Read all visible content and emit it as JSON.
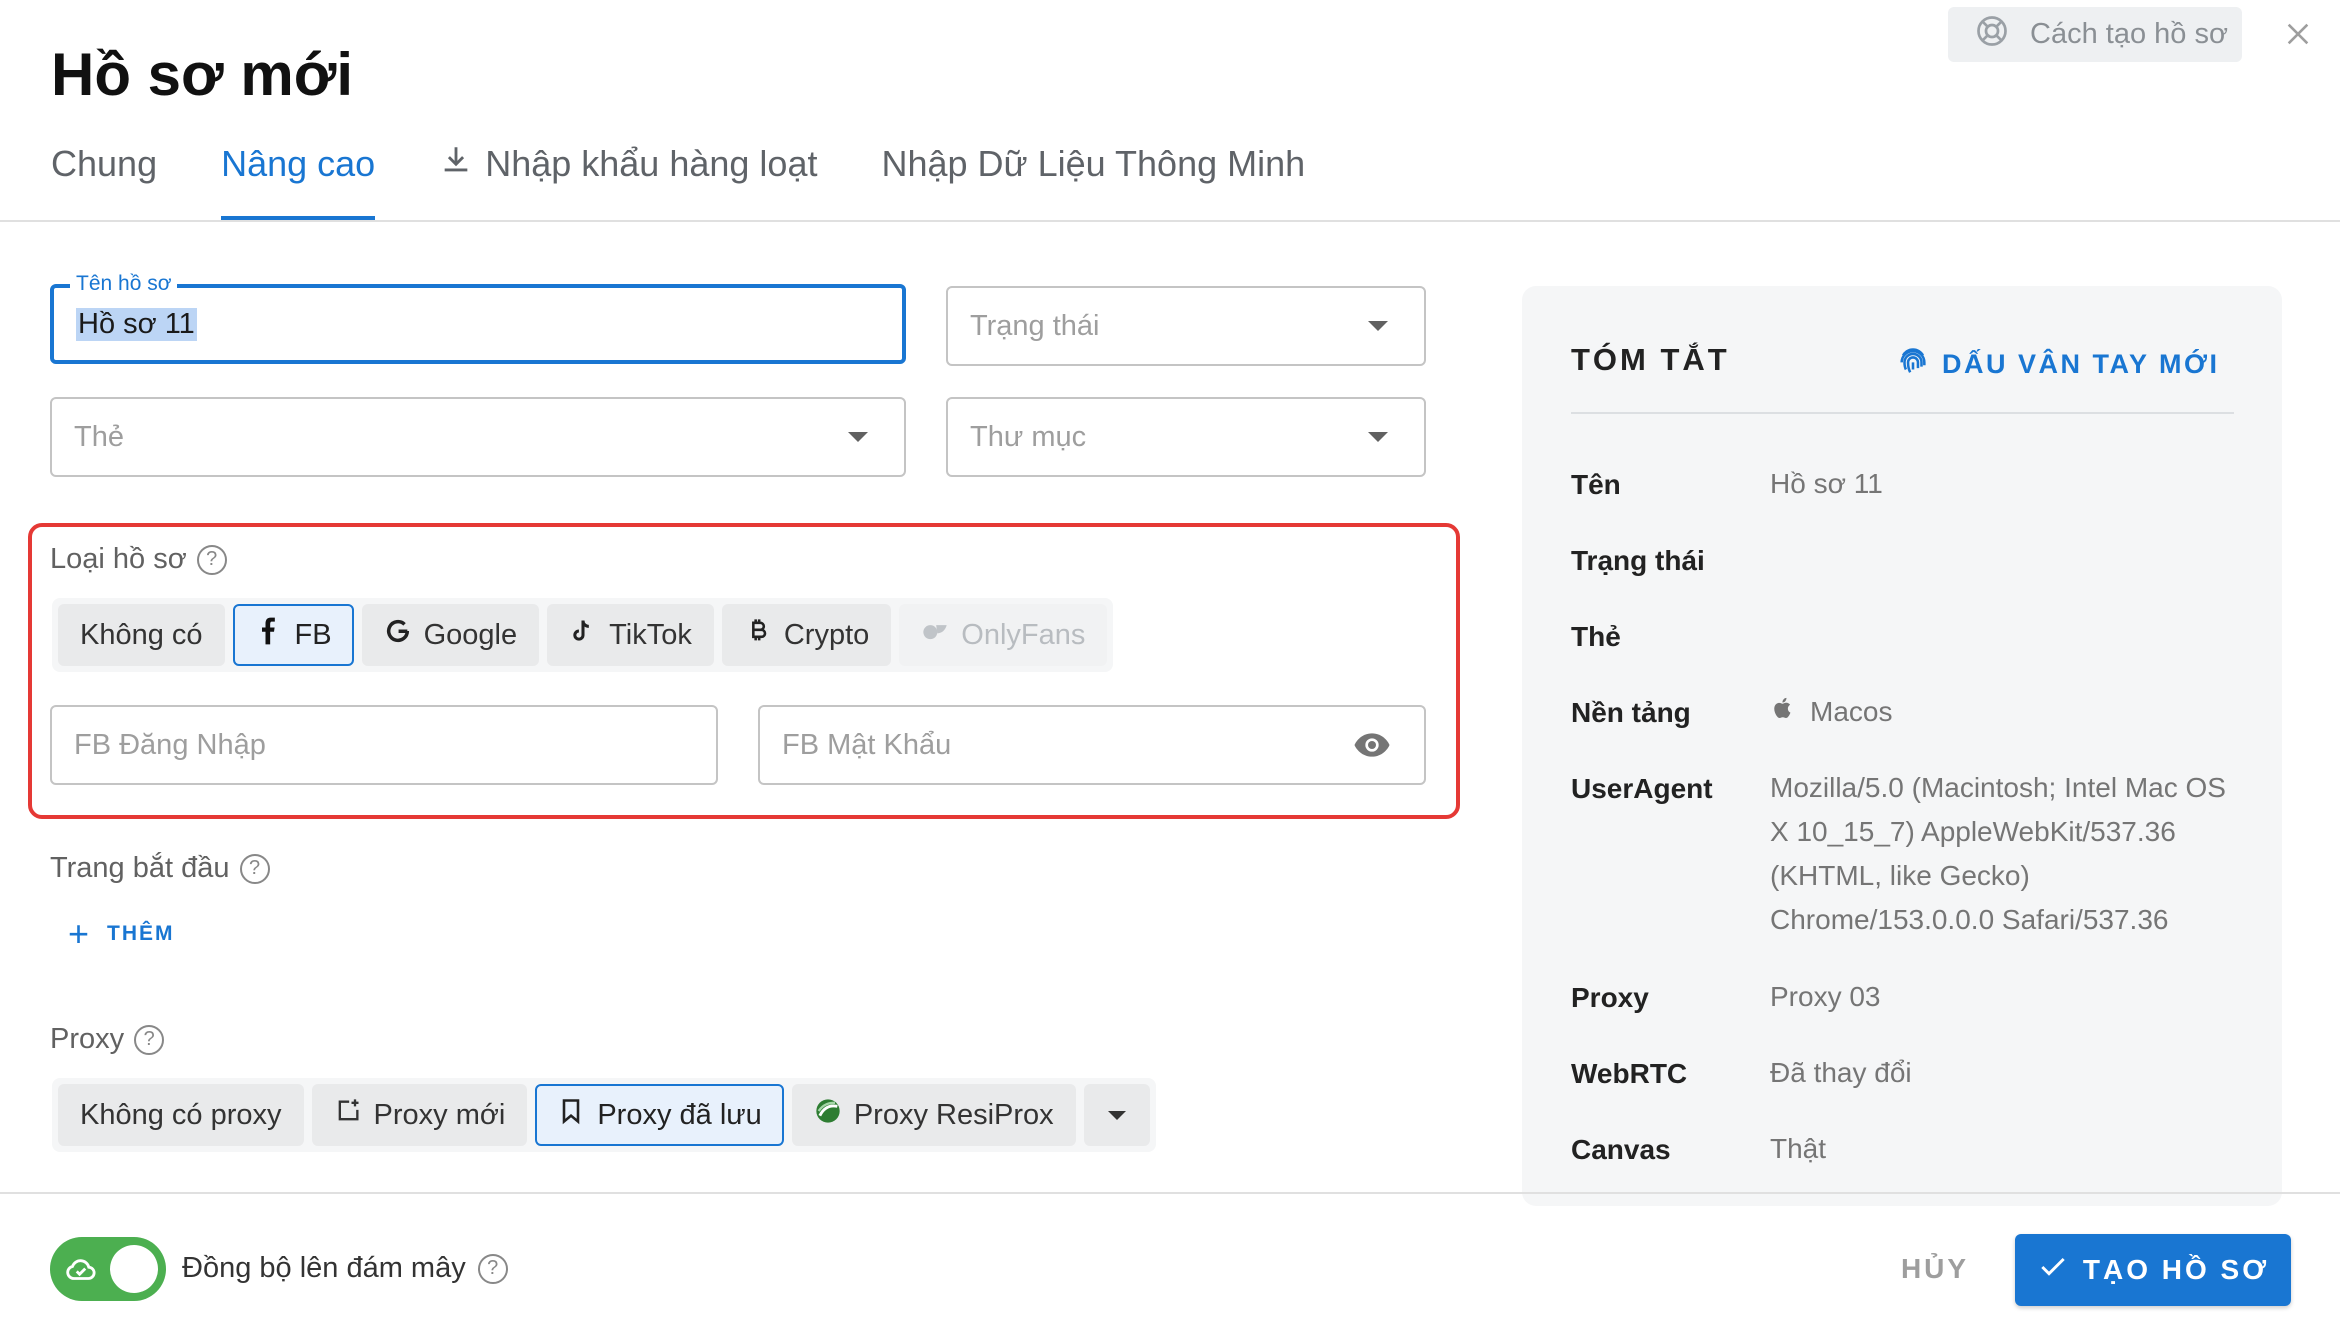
{
  "header": {
    "title": "Hồ sơ mới",
    "help_label": "Cách tạo hồ sơ"
  },
  "tabs": [
    {
      "label": "Chung",
      "active": false
    },
    {
      "label": "Nâng cao",
      "active": true
    },
    {
      "label": "Nhập khẩu hàng loạt",
      "icon": "download-icon",
      "active": false
    },
    {
      "label": "Nhập Dữ Liệu Thông Minh",
      "active": false
    }
  ],
  "form": {
    "profile_name": {
      "legend": "Tên hồ sơ",
      "value": "Hồ sơ 11"
    },
    "status": {
      "placeholder": "Trạng thái"
    },
    "tags": {
      "placeholder": "Thẻ"
    },
    "folder": {
      "placeholder": "Thư mục"
    },
    "profile_type": {
      "label": "Loại hồ sơ",
      "options": [
        "Không có",
        "FB",
        "Google",
        "TikTok",
        "Crypto",
        "OnlyFans"
      ],
      "selected": "FB",
      "disabled": [
        "OnlyFans"
      ]
    },
    "fb_login": {
      "placeholder": "FB Đăng Nhập"
    },
    "fb_password": {
      "placeholder": "FB Mật Khẩu"
    },
    "start_page": {
      "label": "Trang bắt đầu",
      "add_label": "THÊM"
    },
    "proxy": {
      "label": "Proxy",
      "options": [
        "Không có proxy",
        "Proxy mới",
        "Proxy đã lưu",
        "Proxy ResiProx"
      ],
      "selected": "Proxy đã lưu"
    }
  },
  "summary": {
    "title": "TÓM TẮT",
    "fingerprint_link": "DẤU VÂN TAY MỚI",
    "rows": [
      {
        "label": "Tên",
        "value": "Hồ sơ 11"
      },
      {
        "label": "Trạng thái",
        "value": ""
      },
      {
        "label": "Thẻ",
        "value": ""
      },
      {
        "label": "Nền tảng",
        "value": "Macos",
        "icon": "apple-icon"
      },
      {
        "label": "UserAgent",
        "value": "Mozilla/5.0 (Macintosh; Intel Mac OS X 10_15_7) AppleWebKit/537.36 (KHTML, like Gecko) Chrome/153.0.0.0 Safari/537.36"
      },
      {
        "label": "Proxy",
        "value": "Proxy 03"
      },
      {
        "label": "WebRTC",
        "value": "Đã thay đổi"
      },
      {
        "label": "Canvas",
        "value": "Thật"
      }
    ]
  },
  "footer": {
    "sync_label": "Đồng bộ lên đám mây",
    "sync_enabled": true,
    "cancel_label": "HỦY",
    "create_label": "TẠO HỒ SƠ"
  },
  "colors": {
    "accent": "#1976d2",
    "highlight_border": "#e53935",
    "toggle_on": "#4caf50"
  }
}
